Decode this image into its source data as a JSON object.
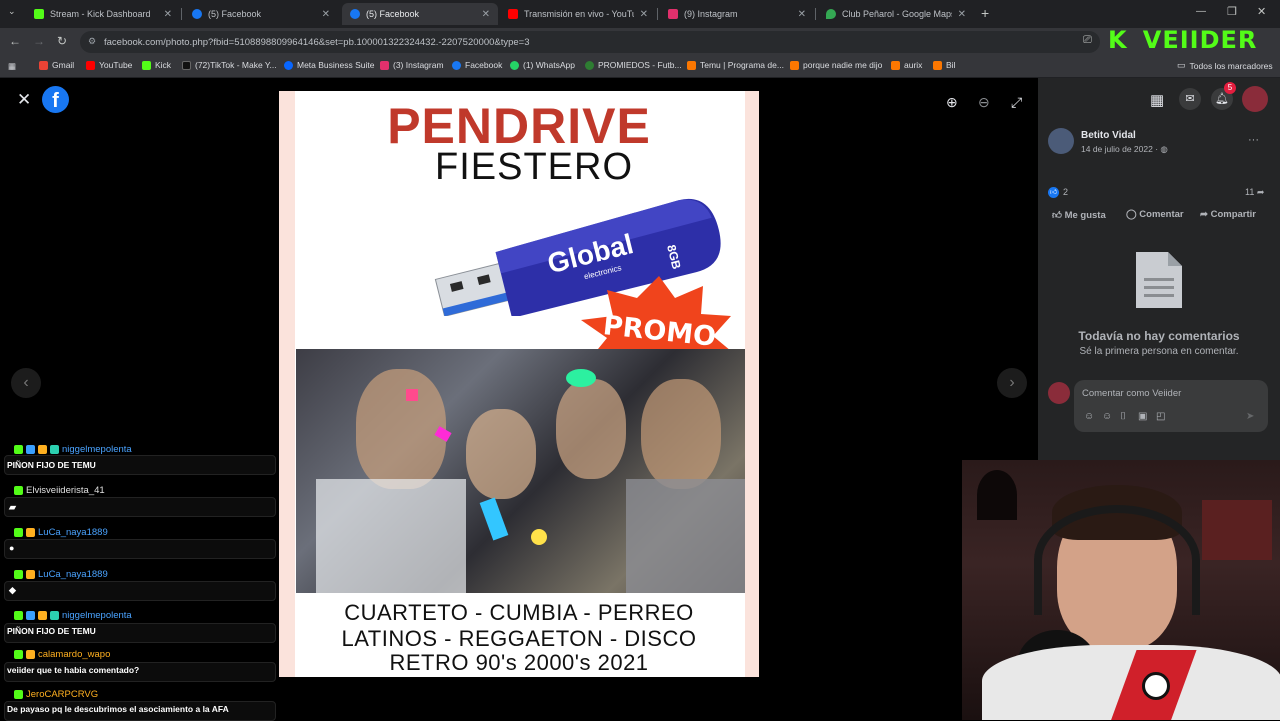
{
  "tabs": [
    {
      "title": "Stream - Kick Dashboard",
      "color": "#53fc18",
      "active": false
    },
    {
      "title": "(5) Facebook",
      "color": "#1877f2",
      "active": false
    },
    {
      "title": "(5) Facebook",
      "color": "#1877f2",
      "active": true
    },
    {
      "title": "Transmisión en vivo - YouTube",
      "color": "#ff0000",
      "active": false
    },
    {
      "title": "(9) Instagram",
      "color": "#e1306c",
      "active": false
    },
    {
      "title": "Club Peñarol - Google Maps",
      "color": "#34a853",
      "active": false
    }
  ],
  "toolbar": {
    "url": "facebook.com/photo.php?fbid=5108898809964146&set=pb.100001322324432.-2207520000&type=3"
  },
  "kick_overlay": "K  VEIIDER",
  "bookmarks": [
    {
      "label": "Gmail",
      "color": "#ea4335"
    },
    {
      "label": "YouTube",
      "color": "#ff0000"
    },
    {
      "label": "Kick",
      "color": "#53fc18"
    },
    {
      "label": "(72)TikTok - Make Y...",
      "color": "#111111"
    },
    {
      "label": "Meta Business Suite",
      "color": "#0866ff"
    },
    {
      "label": "(3) Instagram",
      "color": "#e1306c"
    },
    {
      "label": "Facebook",
      "color": "#1877f2"
    },
    {
      "label": "(1) WhatsApp",
      "color": "#25d366"
    },
    {
      "label": "PROMIEDOS - Futb...",
      "color": "#2e7d32"
    },
    {
      "label": "Temu | Programa de...",
      "color": "#fb7701"
    },
    {
      "label": "porque nadie me dijo",
      "color": "#fb7701"
    },
    {
      "label": "aurix",
      "color": "#fb7701"
    },
    {
      "label": "Bil",
      "color": "#fb7701"
    }
  ],
  "bookmarks_folder": "Todos los marcadores",
  "photo": {
    "title_line1": "PENDRIVE",
    "title_line2": "FIESTERO",
    "usb_brand": "Global",
    "usb_sub": "electronics",
    "usb_capacity": "8GB",
    "promo": "PROMO",
    "genres": [
      "CUARTETO - CUMBIA - PERREO",
      "LATINOS - REGGAETON - DISCO",
      "RETRO 90's 2000's 2021"
    ]
  },
  "panel": {
    "notifications": "5",
    "author": "Betito Vidal",
    "date": "14 de julio de 2022 · ",
    "likes": "2",
    "shares": "11",
    "like_label": "Me gusta",
    "comment_label": "Comentar",
    "share_label": "Compartir",
    "no_comments_title": "Todavía no hay comentarios",
    "no_comments_sub": "Sé la primera persona en comentar.",
    "comment_placeholder": "Comentar como Veiider",
    "more": "···"
  },
  "chat": [
    {
      "user": "niggelmepolenta",
      "color": "#4aa3ff",
      "message": "PIÑON FIJO DE TEMU"
    },
    {
      "user": "Elvisveiiderista_41",
      "color": "#e0e0e0",
      "message": ""
    },
    {
      "user": "LuCa_naya1889",
      "color": "#4aa3ff",
      "message": ""
    },
    {
      "user": "LuCa_naya1889",
      "color": "#4aa3ff",
      "message": ""
    },
    {
      "user": "niggelmepolenta",
      "color": "#4aa3ff",
      "message": "PIÑON FIJO DE TEMU"
    },
    {
      "user": "calamardo_wapo",
      "color": "#ffb020",
      "message": "veiider que te habia comentado?"
    },
    {
      "user": "JeroCARPCRVG",
      "color": "#ffb020",
      "message": "De payaso pq le descubrimos el asociamiento a la AFA"
    }
  ]
}
